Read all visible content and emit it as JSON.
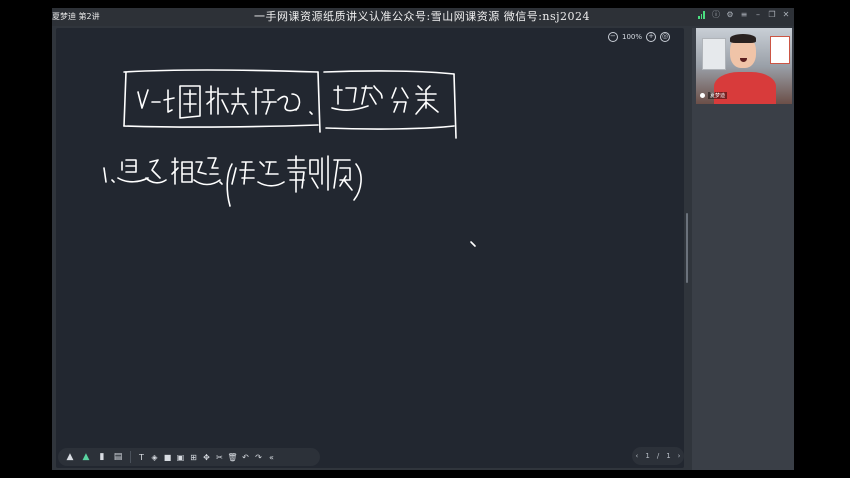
{
  "window": {
    "course_title": "夏梦迪 第2讲",
    "watermark": "一手网课资源纸质讲义认准公众号:雪山网课资源 微信号:nsj2024"
  },
  "board": {
    "zoom_level": "100%",
    "handwriting_note": "V-t图相关技巧 题型分类 1.追及相遇.(传送带剥痕)"
  },
  "pager": {
    "prev": "‹",
    "current": "1",
    "separator": "/",
    "total": "1",
    "next": "›"
  },
  "video": {
    "name_tag": "夏梦迪"
  },
  "colors": {
    "board_bg": "#222730",
    "ink": "#ffffff",
    "app_bg": "#30353c"
  },
  "toolbar": {
    "icons": [
      "pen-icon",
      "highlighter-icon",
      "eraser-icon",
      "note-icon",
      "text-icon",
      "shape-icon",
      "square-icon",
      "image-icon",
      "grid-icon",
      "move-icon",
      "cut-icon",
      "delete-icon",
      "undo-icon",
      "redo-icon",
      "collapse-icon"
    ]
  }
}
